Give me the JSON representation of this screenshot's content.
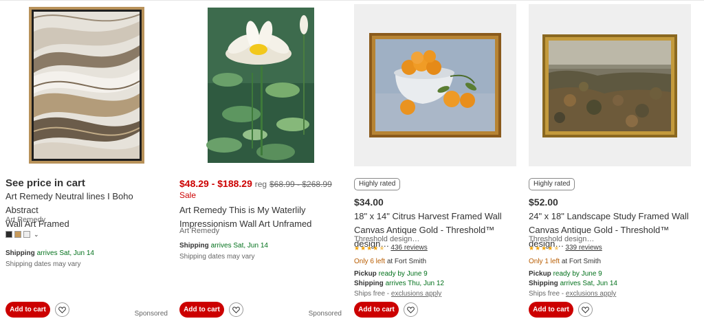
{
  "products": [
    {
      "price_text": "See price in cart",
      "title_line1": "Art Remedy Neutral lines I Boho Abstract",
      "title_line2": "Wall Art Framed",
      "brand": "Art Remedy",
      "swatch_colors": [
        "#2b2b2b",
        "#c79a5a",
        "#eeeeee"
      ],
      "shipping_label": "Shipping",
      "shipping_value": "arrives Sat, Jun 14",
      "shipping_note": "Shipping dates may vary",
      "add_to_cart": "Add to cart",
      "sponsored": "Sponsored"
    },
    {
      "price_range": "$48.29 - $188.29",
      "reg_label": "reg",
      "reg_price": "$68.99 - $268.99",
      "sale_label": "Sale",
      "title_line1": "Art Remedy This is My Waterlily",
      "title_line2": "Impressionism Wall Art Unframed",
      "brand": "Art Remedy",
      "shipping_label": "Shipping",
      "shipping_value": "arrives Sat, Jun 14",
      "shipping_note": "Shipping dates may vary",
      "add_to_cart": "Add to cart",
      "sponsored": "Sponsored"
    },
    {
      "badge": "Highly rated",
      "price": "$34.00",
      "title_line1": "18\" x 14\" Citrus Harvest Framed Wall",
      "title_line2": "Canvas Antique Gold - Threshold™ design…",
      "brand": "Threshold design…",
      "rating": 4.5,
      "reviews": "436 reviews",
      "stock_text": "Only 6 left",
      "stock_location": "at Fort Smith",
      "pickup_label": "Pickup",
      "pickup_value": "ready by June 9",
      "shipping_label": "Shipping",
      "shipping_value": "arrives Thu, Jun 12",
      "ships_free": "Ships free -",
      "exclusions": "exclusions apply",
      "add_to_cart": "Add to cart"
    },
    {
      "badge": "Highly rated",
      "price": "$52.00",
      "title_line1": "24\" x 18\" Landscape Study Framed Wall",
      "title_line2": "Canvas Antique Gold - Threshold™ design…",
      "brand": "Threshold design…",
      "rating": 4.5,
      "reviews": "339 reviews",
      "stock_text": "Only 1 left",
      "stock_location": "at Fort Smith",
      "pickup_label": "Pickup",
      "pickup_value": "ready by June 9",
      "shipping_label": "Shipping",
      "shipping_value": "arrives Sat, Jun 14",
      "ships_free": "Ships free -",
      "exclusions": "exclusions apply",
      "add_to_cart": "Add to cart"
    }
  ],
  "colors": {
    "brand_red": "#cc0000",
    "shipping_green": "#00701a",
    "star_gold": "#f0a000",
    "stock_orange": "#b85c00"
  },
  "icons": {
    "favorite": "heart-icon",
    "swatch_toggle": "chevron-down-icon",
    "rating": "star-icon"
  }
}
